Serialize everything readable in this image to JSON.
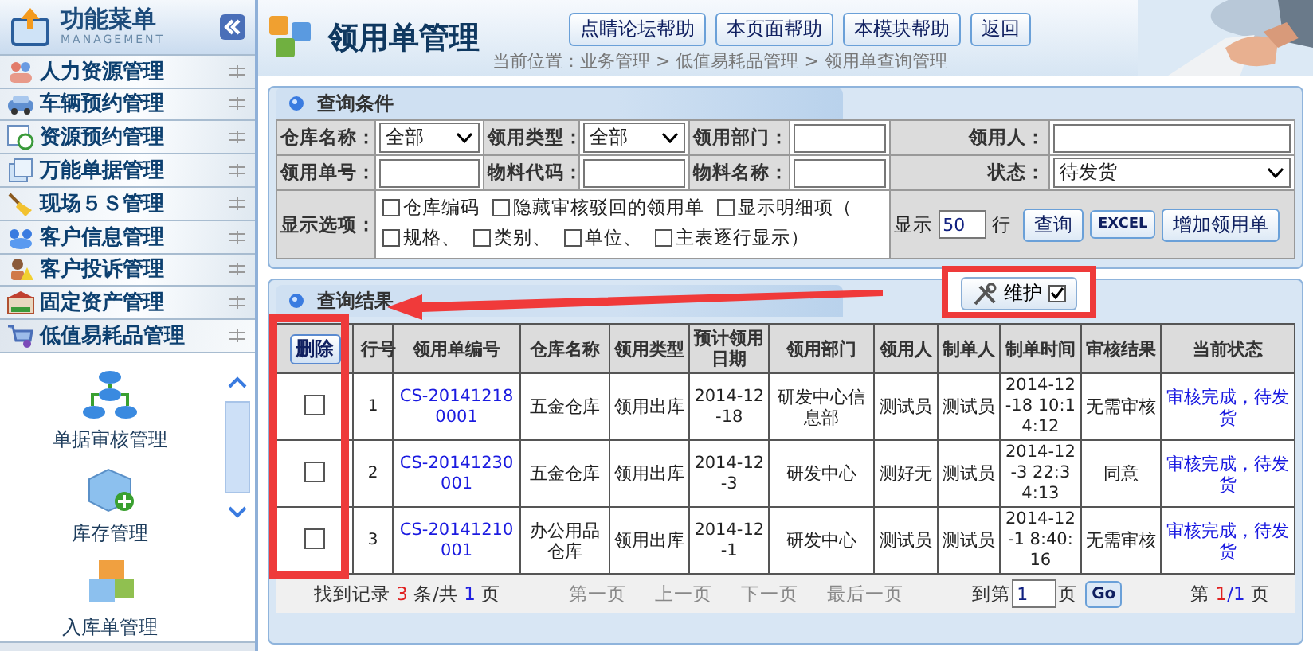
{
  "sidebar": {
    "title": "功能菜单",
    "subtitle": "MANAGEMENT",
    "menu": [
      {
        "label": "人力资源管理",
        "expanded": false
      },
      {
        "label": "车辆预约管理",
        "expanded": false
      },
      {
        "label": "资源预约管理",
        "expanded": false
      },
      {
        "label": "万能单据管理",
        "expanded": false
      },
      {
        "label": "现场５Ｓ管理",
        "expanded": false
      },
      {
        "label": "客户信息管理",
        "expanded": false
      },
      {
        "label": "客户投诉管理",
        "expanded": false
      },
      {
        "label": "固定资产管理",
        "expanded": false
      },
      {
        "label": "低值易耗品管理",
        "expanded": true
      }
    ],
    "modules": [
      {
        "label": "单据审核管理"
      },
      {
        "label": "库存管理"
      },
      {
        "label": "入库单管理"
      }
    ]
  },
  "header": {
    "title": "领用单管理",
    "breadcrumb": "当前位置：业务管理 > 低值易耗品管理 > 领用单查询管理",
    "buttons": [
      "点睛论坛帮助",
      "本页面帮助",
      "本模块帮助",
      "返回"
    ]
  },
  "query": {
    "title": "查询条件",
    "rows": [
      [
        {
          "label": "仓库名称：",
          "kind": "select",
          "value": "全部"
        },
        {
          "label": "领用类型：",
          "kind": "select",
          "value": "全部"
        },
        {
          "label": "领用部门：",
          "kind": "text"
        },
        {
          "label": "领用人：",
          "kind": "text"
        }
      ],
      [
        {
          "label": "领用单号：",
          "kind": "text"
        },
        {
          "label": "物料代码：",
          "kind": "text"
        },
        {
          "label": "物料名称：",
          "kind": "text"
        },
        {
          "label": "状态：",
          "kind": "select",
          "value": "待发货"
        }
      ]
    ],
    "options_label": "显示选项：",
    "options": [
      {
        "label": "仓库编码",
        "checked": false
      },
      {
        "label": "隐藏审核驳回的领用单",
        "checked": false
      },
      {
        "label": "显示明细项（",
        "checked": false
      },
      {
        "label": "规格、",
        "checked": false
      },
      {
        "label": "类别、",
        "checked": false
      },
      {
        "label": "单位、",
        "checked": false
      },
      {
        "label": "主表逐行显示）",
        "checked": false
      }
    ],
    "show_prefix": "显示",
    "show_value": "50",
    "show_suffix": "行",
    "buttons": [
      "查询",
      "EXCEL",
      "增加领用单"
    ]
  },
  "results": {
    "title": "查询结果",
    "maintain": {
      "label": "维护",
      "checked": true
    },
    "delete_button": "删除",
    "columns": [
      "行号",
      "领用单编号",
      "仓库名称",
      "领用类型",
      "预计领用日期",
      "领用部门",
      "领用人",
      "制单人",
      "制单时间",
      "审核结果",
      "当前状态"
    ],
    "rows": [
      {
        "selected": false,
        "cells": [
          "1",
          "CS-201412180001",
          "五金仓库",
          "领用出库",
          "2014-12-18",
          "研发中心信息部",
          "测试员",
          "测试员",
          "2014-12-18 10:14:12",
          "无需审核",
          "审核完成，待发货"
        ]
      },
      {
        "selected": false,
        "cells": [
          "2",
          "CS-20141230001",
          "五金仓库",
          "领用出库",
          "2014-12-3",
          "研发中心",
          "测好无",
          "测试员",
          "2014-12-3 22:34:13",
          "同意",
          "审核完成，待发货"
        ]
      },
      {
        "selected": false,
        "cells": [
          "3",
          "CS-20141210001",
          "办公用品仓库",
          "领用出库",
          "2014-12-1",
          "研发中心",
          "测试员",
          "测试员",
          "2014-12-1 8:40:16",
          "无需审核",
          "审核完成，待发货"
        ]
      }
    ],
    "pager": {
      "found_label": "找到记录",
      "count": "3",
      "count_unit": "条/共",
      "pages": "1",
      "pages_unit": "页",
      "nav": [
        "第一页",
        "上一页",
        "下一页",
        "最后一页"
      ],
      "goto_label": "到第",
      "goto_value": "1",
      "goto_unit": "页",
      "go_button": "Go",
      "page_prefix": "第",
      "current": "1",
      "total": "/1",
      "page_suffix": "页"
    }
  }
}
